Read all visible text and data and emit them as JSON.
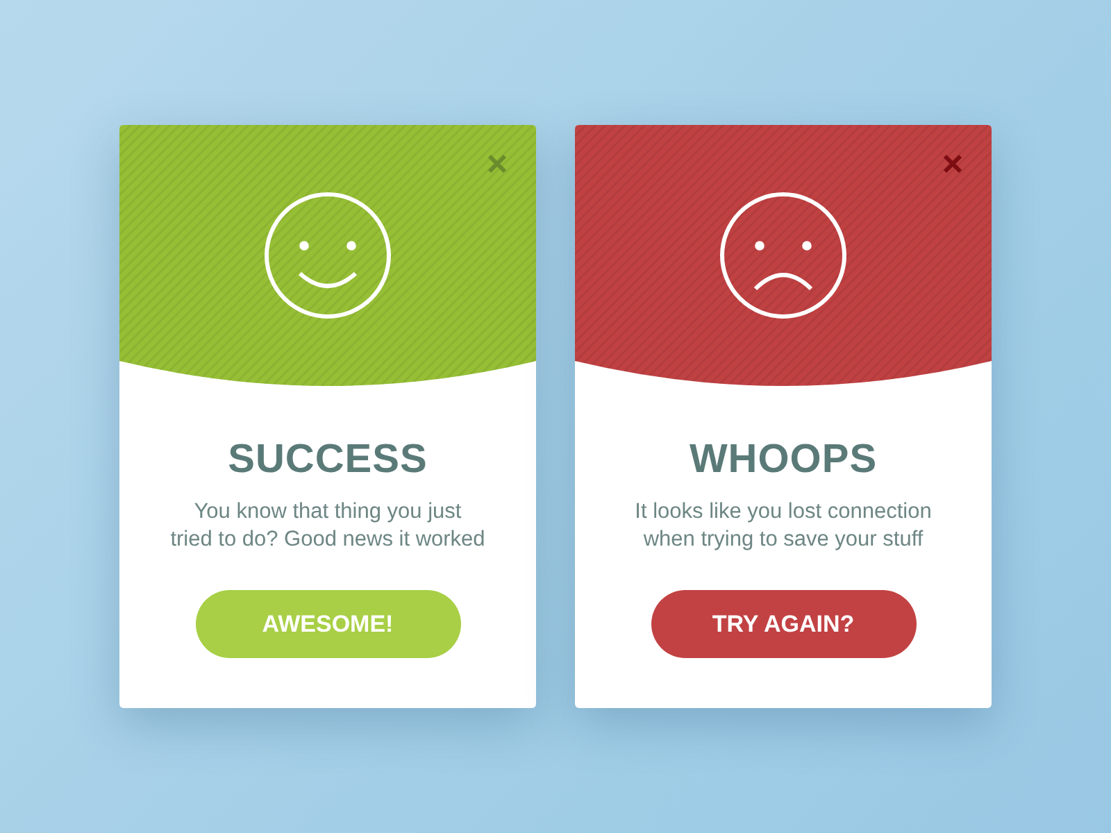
{
  "dialogs": [
    {
      "kind": "success",
      "color": "#96bf35",
      "title": "SUCCESS",
      "message": "You know that thing you just\ntried to do? Good news it worked",
      "button": "AWESOME!"
    },
    {
      "kind": "error",
      "color": "#c04142",
      "title": "WHOOPS",
      "message": "It looks like you lost connection\nwhen trying to save your stuff",
      "button": "TRY AGAIN?"
    }
  ]
}
